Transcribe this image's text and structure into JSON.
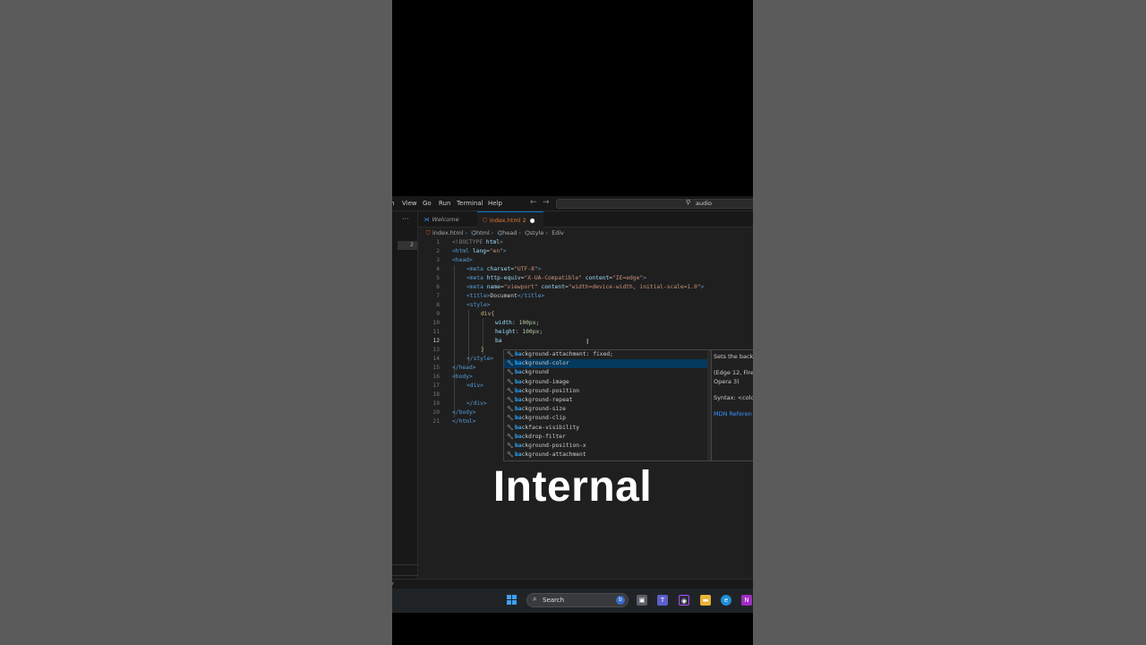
{
  "menu": [
    "View",
    "Go",
    "Run",
    "Terminal",
    "Help"
  ],
  "menu_truncated_left": "n",
  "command_center": "audio",
  "activity": {
    "dots": "···",
    "badge": "2"
  },
  "tabs": [
    {
      "label": "Welcome"
    },
    {
      "label": "index.html 2",
      "modified": "●"
    }
  ],
  "breadcrumb": [
    "index.html",
    "html",
    "head",
    "style",
    "div"
  ],
  "code_lines": [
    {
      "n": "1"
    },
    {
      "n": "2"
    },
    {
      "n": "3"
    },
    {
      "n": "4"
    },
    {
      "n": "5"
    },
    {
      "n": "6"
    },
    {
      "n": "7"
    },
    {
      "n": "8"
    },
    {
      "n": "9"
    },
    {
      "n": "10"
    },
    {
      "n": "11"
    },
    {
      "n": "12"
    },
    {
      "n": "13"
    },
    {
      "n": "14"
    },
    {
      "n": "15"
    },
    {
      "n": "16"
    },
    {
      "n": "17"
    },
    {
      "n": "18"
    },
    {
      "n": "19"
    },
    {
      "n": "20"
    },
    {
      "n": "21"
    }
  ],
  "code": {
    "l1": [
      "<!DOCTYPE",
      " html",
      ">"
    ],
    "l2": [
      "<html",
      " lang",
      "=",
      "\"en\"",
      ">"
    ],
    "l3": [
      "<head>"
    ],
    "l4": [
      "<meta",
      " charset",
      "=",
      "\"UTF-8\"",
      ">"
    ],
    "l5": [
      "<meta",
      " http-equiv",
      "=",
      "\"X-UA-Compatible\"",
      " content",
      "=",
      "\"IE=edge\"",
      ">"
    ],
    "l6": [
      "<meta",
      " name",
      "=",
      "\"viewport\"",
      " content",
      "=",
      "\"width=device-width, initial-scale=1.0\"",
      ">"
    ],
    "l7": [
      "<title>",
      "Document",
      "</title>"
    ],
    "l8": [
      "<style>"
    ],
    "l9": [
      "div",
      "{"
    ],
    "l10": [
      "width",
      ": ",
      "100px",
      ";"
    ],
    "l11": [
      "height",
      ": ",
      "100px",
      ";"
    ],
    "l12": [
      "ba"
    ],
    "l13": [
      "}"
    ],
    "l14": [
      "</style>"
    ],
    "l15": [
      "</head>"
    ],
    "l16": [
      "<body>"
    ],
    "l17": [
      "<div>"
    ],
    "l19": [
      "</div>"
    ],
    "l20": [
      "</body>"
    ],
    "l21": [
      "</html>"
    ]
  },
  "suggestions": [
    {
      "match": "ba",
      "rest": "ckground-attachment: fixed;"
    },
    {
      "match": "ba",
      "rest": "ckground-color"
    },
    {
      "match": "ba",
      "rest": "ckground"
    },
    {
      "match": "ba",
      "rest": "ckground-image"
    },
    {
      "match": "ba",
      "rest": "ckground-position"
    },
    {
      "match": "ba",
      "rest": "ckground-repeat"
    },
    {
      "match": "ba",
      "rest": "ckground-size"
    },
    {
      "match": "ba",
      "rest": "ckground-clip"
    },
    {
      "match": "ba",
      "rest": "ckface-visibility"
    },
    {
      "match": "ba",
      "rest": "ckdrop-filter"
    },
    {
      "match": "ba",
      "rest": "ckground-position-x"
    },
    {
      "match": "ba",
      "rest": "ckground-attachment"
    }
  ],
  "docs": {
    "line1": "Sets the back",
    "line2": "(Edge 12, Fire",
    "line3": "Opera 3)",
    "line4": "Syntax: <colo",
    "link": "MDN Referen"
  },
  "taskbar": {
    "search": "Search"
  },
  "caption": "Internal",
  "colors": {
    "accent": "#0078d4",
    "html_icon": "#e44d26",
    "tag": "#569cd6",
    "attr": "#9cdcfe",
    "string": "#ce9178"
  }
}
